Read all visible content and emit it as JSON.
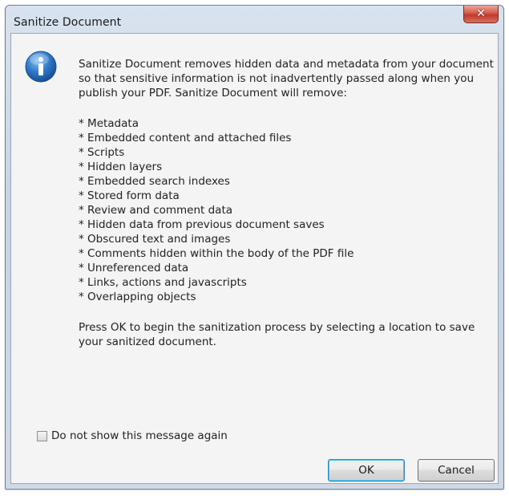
{
  "window": {
    "title": "Sanitize Document",
    "close_glyph": "✕"
  },
  "message": {
    "intro": "Sanitize Document removes hidden data and metadata from your document so that sensitive information is not inadvertently passed along when you publish your PDF. Sanitize Document will remove:",
    "items": [
      "* Metadata",
      "* Embedded content and attached files",
      "* Scripts",
      "* Hidden layers",
      "* Embedded search indexes",
      "* Stored form data",
      "* Review and comment data",
      "* Hidden data from previous document saves",
      "* Obscured text and images",
      "* Comments hidden within the body of the PDF file",
      "* Unreferenced data",
      "* Links, actions and javascripts",
      "* Overlapping objects"
    ],
    "outro": "Press OK to begin the sanitization process by selecting a location to save your sanitized document."
  },
  "checkbox": {
    "label": "Do not show this message again",
    "checked": false
  },
  "buttons": {
    "ok_label": "OK",
    "cancel_label": "Cancel"
  },
  "icons": {
    "info": "info-icon",
    "close": "close-icon"
  }
}
